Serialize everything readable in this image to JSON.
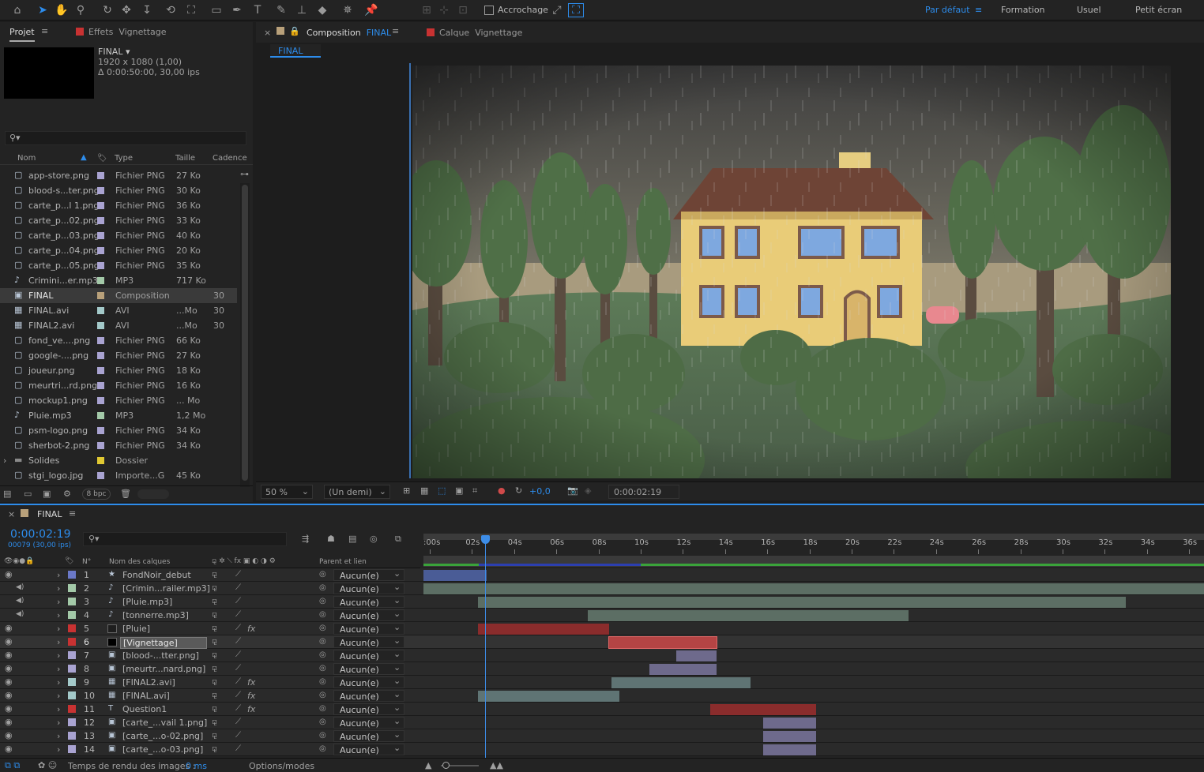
{
  "toolbar": {
    "snapping_label": "Accrochage",
    "workspaces": [
      "Par défaut",
      "Formation",
      "Usuel",
      "Petit écran"
    ]
  },
  "project": {
    "tab_label": "Projet",
    "effects_tab": "Effets",
    "effects_target": "Vignettage",
    "preview": {
      "name": "FINAL",
      "size": "1920 x 1080 (1,00)",
      "duration": "Δ 0:00:50:00, 30,00 ips"
    },
    "search_placeholder": "",
    "columns": [
      "Nom",
      "Type",
      "Taille",
      "Cadence"
    ],
    "items": [
      {
        "name": "app-store.png",
        "type": "Fichier PNG",
        "size": "27 Ko",
        "rate": "",
        "color": "#a9a3d1",
        "icon": "png"
      },
      {
        "name": "blood-s...ter.png",
        "type": "Fichier PNG",
        "size": "30 Ko",
        "rate": "",
        "color": "#a9a3d1",
        "icon": "png"
      },
      {
        "name": "carte_p...l 1.png",
        "type": "Fichier PNG",
        "size": "36 Ko",
        "rate": "",
        "color": "#a9a3d1",
        "icon": "png"
      },
      {
        "name": "carte_p...02.png",
        "type": "Fichier PNG",
        "size": "33 Ko",
        "rate": "",
        "color": "#a9a3d1",
        "icon": "png"
      },
      {
        "name": "carte_p...03.png",
        "type": "Fichier PNG",
        "size": "40 Ko",
        "rate": "",
        "color": "#a9a3d1",
        "icon": "png"
      },
      {
        "name": "carte_p...04.png",
        "type": "Fichier PNG",
        "size": "20 Ko",
        "rate": "",
        "color": "#a9a3d1",
        "icon": "png"
      },
      {
        "name": "carte_p...05.png",
        "type": "Fichier PNG",
        "size": "35 Ko",
        "rate": "",
        "color": "#a9a3d1",
        "icon": "png"
      },
      {
        "name": "Crimini...er.mp3",
        "type": "MP3",
        "size": "717 Ko",
        "rate": "",
        "color": "#a3c9a8",
        "icon": "audio"
      },
      {
        "name": "FINAL",
        "type": "Composition",
        "size": "",
        "rate": "30",
        "color": "#b8a07a",
        "icon": "comp",
        "selected": true
      },
      {
        "name": "FINAL.avi",
        "type": "AVI",
        "size": "...Mo",
        "rate": "30",
        "color": "#a3c9c9",
        "icon": "video"
      },
      {
        "name": "FINAL2.avi",
        "type": "AVI",
        "size": "...Mo",
        "rate": "30",
        "color": "#a3c9c9",
        "icon": "video"
      },
      {
        "name": "fond_ve....png",
        "type": "Fichier PNG",
        "size": "66 Ko",
        "rate": "",
        "color": "#a9a3d1",
        "icon": "png"
      },
      {
        "name": "google-....png",
        "type": "Fichier PNG",
        "size": "27 Ko",
        "rate": "",
        "color": "#a9a3d1",
        "icon": "png"
      },
      {
        "name": "joueur.png",
        "type": "Fichier PNG",
        "size": "18 Ko",
        "rate": "",
        "color": "#a9a3d1",
        "icon": "png"
      },
      {
        "name": "meurtri...rd.png",
        "type": "Fichier PNG",
        "size": "16 Ko",
        "rate": "",
        "color": "#a9a3d1",
        "icon": "png"
      },
      {
        "name": "mockup1.png",
        "type": "Fichier PNG",
        "size": "... Mo",
        "rate": "",
        "color": "#a9a3d1",
        "icon": "png"
      },
      {
        "name": "Pluie.mp3",
        "type": "MP3",
        "size": "1,2 Mo",
        "rate": "",
        "color": "#a3c9a8",
        "icon": "audio"
      },
      {
        "name": "psm-logo.png",
        "type": "Fichier PNG",
        "size": "34 Ko",
        "rate": "",
        "color": "#a9a3d1",
        "icon": "png"
      },
      {
        "name": "sherbot-2.png",
        "type": "Fichier PNG",
        "size": "34 Ko",
        "rate": "",
        "color": "#a9a3d1",
        "icon": "png"
      },
      {
        "name": "Solides",
        "type": "Dossier",
        "size": "",
        "rate": "",
        "color": "#e0c832",
        "icon": "folder"
      },
      {
        "name": "stgi_logo.jpg",
        "type": "Importe...G",
        "size": "45 Ko",
        "rate": "",
        "color": "#a9a3d1",
        "icon": "png"
      }
    ],
    "bpc": "8 bpc"
  },
  "composition": {
    "tab_label": "Composition",
    "tab_name": "FINAL",
    "layer_tab": "Calque",
    "layer_name": "Vignettage",
    "breadcrumb": "FINAL",
    "zoom": "50 %",
    "resolution": "(Un demi)",
    "exposure": "+0,0",
    "timecode": "0:00:02:19"
  },
  "timeline": {
    "tab_label": "FINAL",
    "timecode": "0:00:02:19",
    "frame_info": "00079 (30,00 ips)",
    "col_num": "N°",
    "col_name": "Nom des calques",
    "col_parent": "Parent et lien",
    "ruler": [
      ":00s",
      "02s",
      "04s",
      "06s",
      "08s",
      "10s",
      "12s",
      "14s",
      "16s",
      "18s",
      "20s",
      "22s",
      "24s",
      "26s",
      "28s",
      "30s",
      "32s",
      "34s",
      "36s"
    ],
    "playhead_s": 2.63,
    "layers": [
      {
        "num": "1",
        "name": "FondNoir_debut",
        "color": "#6b79c8",
        "type": "star",
        "parent": "Aucun(e)",
        "eye": true,
        "audio": false,
        "fx": false,
        "in": 0,
        "out": 2.7,
        "bar": "#4a5c96"
      },
      {
        "num": "2",
        "name": "[Crimin...railer.mp3]",
        "color": "#a3c9a8",
        "type": "audio",
        "parent": "Aucun(e)",
        "eye": false,
        "audio": true,
        "fx": false,
        "in": 0,
        "out": 37,
        "bar": "#5c6e64"
      },
      {
        "num": "3",
        "name": "[Pluie.mp3]",
        "color": "#a3c9a8",
        "type": "audio",
        "parent": "Aucun(e)",
        "eye": false,
        "audio": true,
        "fx": false,
        "in": 2.3,
        "out": 33,
        "bar": "#5c6e64"
      },
      {
        "num": "4",
        "name": "[tonnerre.mp3]",
        "color": "#a3c9a8",
        "type": "audio",
        "parent": "Aucun(e)",
        "eye": false,
        "audio": true,
        "fx": false,
        "in": 7.5,
        "out": 22.7,
        "bar": "#5c6e64"
      },
      {
        "num": "5",
        "name": "[Pluie]",
        "color": "#c83232",
        "type": "solid",
        "parent": "Aucun(e)",
        "eye": true,
        "audio": false,
        "fx": true,
        "in": 2.3,
        "out": 8.5,
        "bar": "#8a2c2c"
      },
      {
        "num": "6",
        "name": "[Vignettage]",
        "color": "#c83232",
        "type": "solid-black",
        "parent": "Aucun(e)",
        "eye": true,
        "audio": false,
        "fx": false,
        "in": 8.5,
        "out": 13.6,
        "bar": "#b44444",
        "selected": true
      },
      {
        "num": "7",
        "name": "[blood-...tter.png]",
        "color": "#a9a3d1",
        "type": "png",
        "parent": "Aucun(e)",
        "eye": true,
        "audio": false,
        "fx": false,
        "in": 11.7,
        "out": 13.6,
        "bar": "#6e6a8c"
      },
      {
        "num": "8",
        "name": "[meurtr...nard.png]",
        "color": "#a9a3d1",
        "type": "png",
        "parent": "Aucun(e)",
        "eye": true,
        "audio": false,
        "fx": false,
        "in": 10.4,
        "out": 13.6,
        "bar": "#6e6a8c"
      },
      {
        "num": "9",
        "name": "[FINAL2.avi]",
        "color": "#a3c9c9",
        "type": "video",
        "parent": "Aucun(e)",
        "eye": true,
        "audio": false,
        "fx": true,
        "in": 8.6,
        "out": 15.2,
        "bar": "#5f7474"
      },
      {
        "num": "10",
        "name": "[FINAL.avi]",
        "color": "#a3c9c9",
        "type": "video",
        "parent": "Aucun(e)",
        "eye": true,
        "audio": false,
        "fx": true,
        "in": 2.3,
        "out": 9,
        "bar": "#5f7474"
      },
      {
        "num": "11",
        "name": "Question1",
        "color": "#c83232",
        "type": "text",
        "parent": "Aucun(e)",
        "eye": true,
        "audio": false,
        "fx": true,
        "in": 13.3,
        "out": 18.3,
        "bar": "#8a2c2c"
      },
      {
        "num": "12",
        "name": "[carte_...vail 1.png]",
        "color": "#a9a3d1",
        "type": "png",
        "parent": "Aucun(e)",
        "eye": true,
        "audio": false,
        "fx": false,
        "in": 15.8,
        "out": 18.3,
        "bar": "#6e6a8c"
      },
      {
        "num": "13",
        "name": "[carte_...o-02.png]",
        "color": "#a9a3d1",
        "type": "png",
        "parent": "Aucun(e)",
        "eye": true,
        "audio": false,
        "fx": false,
        "in": 15.8,
        "out": 18.3,
        "bar": "#6e6a8c"
      },
      {
        "num": "14",
        "name": "[carte_...o-03.png]",
        "color": "#a9a3d1",
        "type": "png",
        "parent": "Aucun(e)",
        "eye": true,
        "audio": false,
        "fx": false,
        "in": 15.8,
        "out": 18.3,
        "bar": "#6e6a8c"
      }
    ]
  },
  "status": {
    "render_label": "Temps de rendu des images :",
    "render_value": "0 ms",
    "options_label": "Options/modes"
  }
}
